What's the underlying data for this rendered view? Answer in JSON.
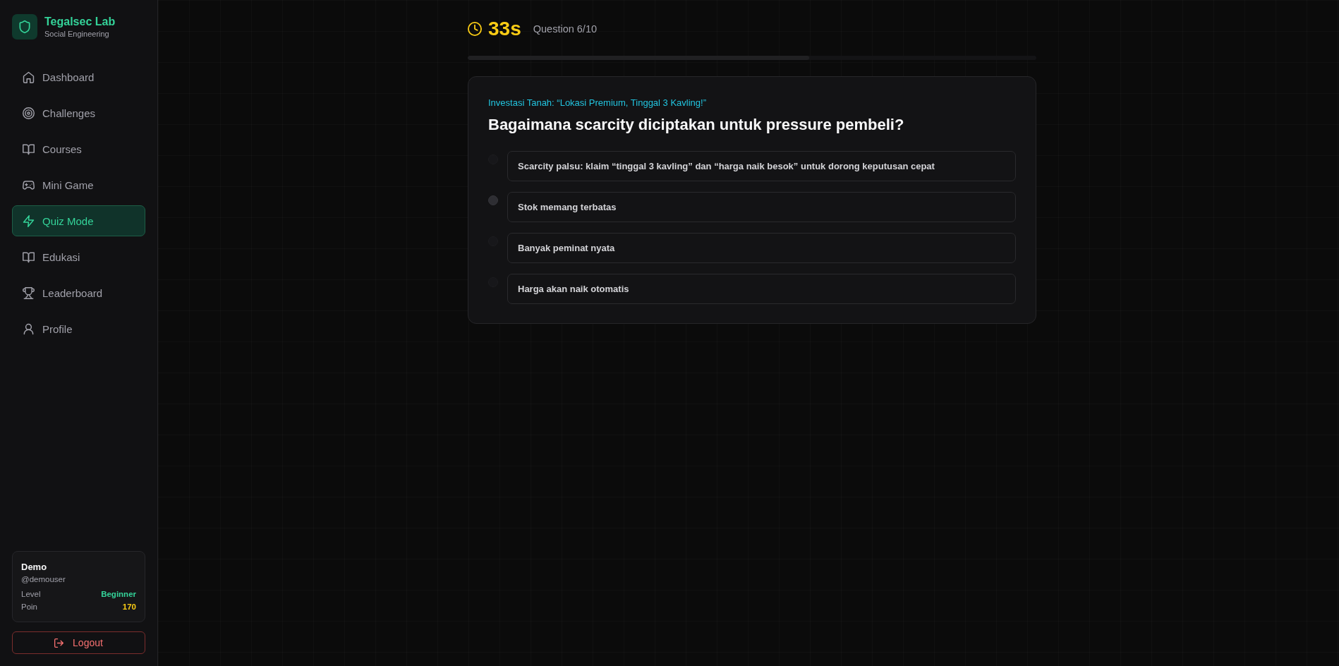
{
  "sidebar": {
    "brand": {
      "title": "Tegalsec Lab",
      "subtitle": "Social Engineering"
    },
    "items": [
      {
        "label": "Dashboard",
        "selected": false
      },
      {
        "label": "Challenges",
        "selected": false
      },
      {
        "label": "Courses",
        "selected": false
      },
      {
        "label": "Mini Game",
        "selected": false
      },
      {
        "label": "Quiz Mode",
        "selected": true
      },
      {
        "label": "Edukasi",
        "selected": false
      },
      {
        "label": "Leaderboard",
        "selected": false
      },
      {
        "label": "Profile",
        "selected": false
      }
    ],
    "user": {
      "name": "Demo",
      "handle": "@demouser",
      "stats": [
        {
          "label": "Level",
          "value": "Beginner",
          "color": "#34d399"
        },
        {
          "label": "Poin",
          "value": "170",
          "color": "#facc15"
        }
      ]
    },
    "logout": "Logout"
  },
  "quiz": {
    "timer": "33s",
    "counter": "Question 6/10",
    "progress": {
      "level": 0.6
    },
    "category": "Investasi Tanah: “Lokasi Premium, Tinggal 3 Kavling!”",
    "question": "Bagaimana scarcity diciptakan untuk pressure pembeli?",
    "options": [
      {
        "text": "Scarcity palsu: klaim “tinggal 3 kavling” dan “harga naik besok” untuk dorong keputusan cepat",
        "selected": false,
        "hovered": false
      },
      {
        "text": "Stok memang terbatas",
        "selected": false,
        "hovered": true
      },
      {
        "text": "Banyak peminat nyata",
        "selected": false,
        "hovered": false
      },
      {
        "text": "Harga akan naik otomatis",
        "selected": false,
        "hovered": false
      }
    ]
  }
}
